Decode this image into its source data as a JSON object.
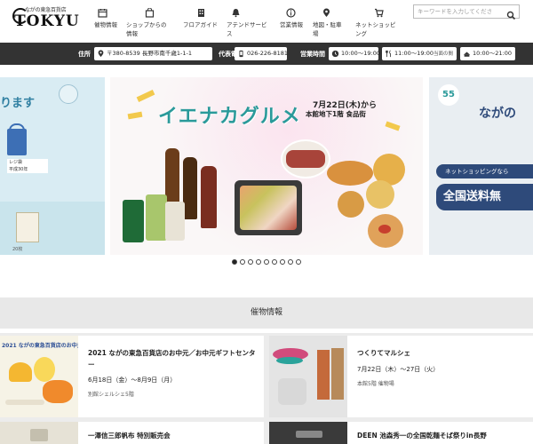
{
  "brand": {
    "tagline": "ながの東急百貨店",
    "wordmark": "TOKYU"
  },
  "nav": [
    {
      "label": "催物情報",
      "icon": "calendar-icon"
    },
    {
      "label": "ショップからの情報",
      "icon": "shop-bag-icon"
    },
    {
      "label": "フロアガイド",
      "icon": "building-icon"
    },
    {
      "label": "アテンドサービス",
      "icon": "bell-icon"
    },
    {
      "label": "営業情報",
      "icon": "info-icon"
    },
    {
      "label": "地図・駐車場",
      "icon": "map-pin-icon"
    },
    {
      "label": "ネットショッピング",
      "icon": "cart-icon"
    }
  ],
  "search": {
    "placeholder": "キーワードを入力してくださ",
    "icon": "search-icon"
  },
  "info": {
    "address_label": "住所",
    "address": "〒380-8539 長野市南千歳1-1-1",
    "phone_label": "代表電話",
    "phone": "026-226-8181",
    "hours_label": "営業時間",
    "hours_main": "10:00～19:00",
    "hours_sub": "11:00～19:00",
    "hours_sub_note": "当面の間",
    "hours_annex": "10:00～21:00"
  },
  "banner_left": {
    "text": "ります",
    "bag_tag_1": "平成30年",
    "bag_tag_2": "20枚",
    "caption": "レジ袋"
  },
  "banner_main": {
    "title": "イエナカグルメ",
    "date_line": "7月22日(木)から",
    "floor_line": "本館地下1階 食品街"
  },
  "banner_right": {
    "title": "ながの",
    "pill_1": "ネットショッピングなら",
    "pill_2": "全国送料無",
    "badge": "55"
  },
  "slider": {
    "dot_count": 9,
    "active": 0
  },
  "section": {
    "title": "催物情報"
  },
  "cards": [
    {
      "thumb_caption": "2021 ながの東急百貨店のお中元",
      "title": "2021 ながの東急百貨店のお中元／お中元ギフトセンター",
      "date": "6月18日（金）～8月9日（月）",
      "place": "別館シェルシェ5階"
    },
    {
      "title": "つくりてマルシェ",
      "date": "7月22日（木）～27日（火）",
      "place": "本館5階 催物場"
    },
    {
      "title": "一澤信三郎帆布 特別販売会"
    },
    {
      "title": "DEEN 池森秀一の全国乾麺そば祭りin長野"
    }
  ],
  "colors": {
    "infobar": "#333333",
    "accent": "#e9528e",
    "banner_title": "#2a9a9a"
  }
}
